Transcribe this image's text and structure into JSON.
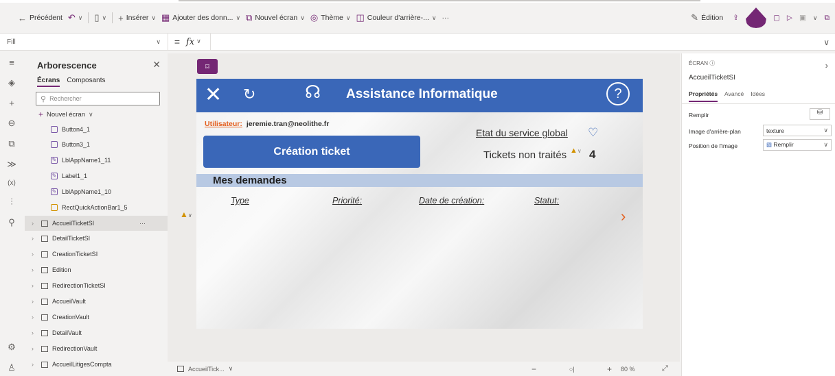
{
  "command_bar": {
    "back": "Précédent",
    "insert": "Insérer",
    "add_data": "Ajouter des donn...",
    "new_screen": "Nouvel écran",
    "theme": "Thème",
    "background": "Couleur d'arrière-...",
    "more": "···",
    "edit": "Édition"
  },
  "formula_bar": {
    "property": "Fill",
    "equals": "=",
    "fx": "fx"
  },
  "tree": {
    "title": "Arborescence",
    "tab_screens": "Écrans",
    "tab_components": "Composants",
    "search_placeholder": "Rechercher",
    "new_screen": "Nouvel écran",
    "controls": [
      "Button4_1",
      "Button3_1",
      "LblAppName1_11",
      "Label1_1",
      "LblAppName1_10",
      "RectQuickActionBar1_5"
    ],
    "screens": [
      "AccueilTicketSI",
      "DetailTicketSI",
      "CreationTicketSI",
      "Edition",
      "RedirectionTicketSI",
      "AccueilVault",
      "CreationVault",
      "DetailVault",
      "RedirectionVault",
      "AccueilLitigesCompta"
    ],
    "more": "···"
  },
  "app": {
    "title": "Assistance Informatique",
    "user_label": "Utilisateur:",
    "user_email": "jeremie.tran@neolithe.fr",
    "create_button": "Création ticket",
    "service_status": "Etat du service global",
    "tickets_label": "Tickets non traités",
    "tickets_count": "4",
    "requests_title": "Mes demandes",
    "columns": [
      "Type",
      "Priorité:",
      "Date de création:",
      "Statut:"
    ]
  },
  "canvas_footer": {
    "screen": "AccueilTick...",
    "zoom": "80 %"
  },
  "properties": {
    "kind": "ÉCRAN",
    "name": "AccueilTicketSI",
    "tab_properties": "Propriétés",
    "tab_advanced": "Avancé",
    "tab_ideas": "Idées",
    "fill_label": "Remplir",
    "bg_image_label": "Image d'arrière-plan",
    "bg_image_value": "texture",
    "image_position_label": "Position de l'image",
    "image_position_value": "Remplir"
  }
}
